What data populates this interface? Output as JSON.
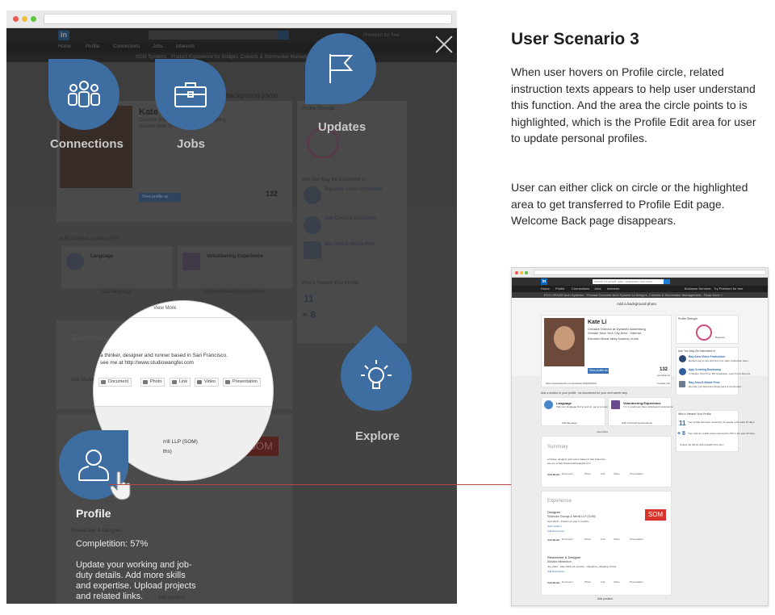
{
  "scenario": {
    "title": "User Scenario 3",
    "paragraph1": "When user hovers on Profile circle, related instruction texts appears to help user understand this function. And the area the circle points to is highlighted, which is the Profile Edit area for user to update personal profiles.",
    "paragraph2": "User can either click on circle or the highlighted area to get transferred to Profile Edit page. Welcome Back page disappears."
  },
  "overlay": {
    "connections_label": "Connections",
    "jobs_label": "Jobs",
    "updates_label": "Updates",
    "explore_label": "Explore",
    "profile_label": "Profile",
    "profile_completion": "Completition: 57%",
    "profile_description": "Update your working and job-duty details. Add more skills and expertise. Upload projects and related links."
  },
  "magnifier": {
    "view_more": "View More",
    "summary_line1": "a thinker, designer and runner based in San Francisco.",
    "summary_line2": "see me at http://www.studiowangfei.com",
    "media_buttons": [
      "Document",
      "Photo",
      "Link",
      "Video",
      "Presentation"
    ],
    "company_fragment": "rrill LLP (SOM)",
    "dates_fragment": "ths)"
  },
  "dim_page": {
    "logo": "in",
    "nav": [
      "Home",
      "Profile",
      "Connections",
      "Jobs",
      "Interests"
    ],
    "premium": "Premium for free",
    "banner": "SOM Systems · Product Experience for Bridges, Culverts & Stormwater Management",
    "bg_photo": "background photo",
    "name": "Kate Li",
    "headline": "Creative Director at Dynamic Advertising",
    "location": "Greater New York City Area",
    "view_profile": "View profile as",
    "connections_count": "132",
    "profile_strength": "Profile Strength",
    "ads_title": "Ads You May Be Interested In",
    "ad1": "Bay Area Video Production",
    "ad2": "App Creating Bootcamp",
    "ad3": "Bay Area E-Waste Pros",
    "who_viewed": "Who's Viewed Your Profile",
    "viewed_count": "11",
    "rank_change": "+ 8",
    "add_section": "Add a section to your profile",
    "language": "Language",
    "volunteering": "Volunteering Experience",
    "add_language": "Add language",
    "add_volunteering": "Add volunteering experience",
    "summary": "Summary",
    "add_media": "Add Media",
    "researcher": "Researcher & Designer",
    "add_position": "Add position",
    "som": "SOM"
  },
  "mini": {
    "logo": "in",
    "search_placeholder": "Search for people, jobs, companies, and more...",
    "nav": [
      "Home",
      "Profile",
      "Connections",
      "Jobs",
      "Interests"
    ],
    "nav_right": [
      "Business Services",
      "Try Premium for free"
    ],
    "banner": "ECO-SPAN® Arch Systems - Precast Concrete Arch System for Bridges, Culverts & Stormwater Management - Read More »",
    "add_bg_photo": "Add a background photo",
    "name": "Kate Li",
    "headline": "Creative Director at Dynamic Advertising",
    "location": "Greater New York City Area · Internet",
    "education": "Education   Illinois Valley Academy of Arts",
    "view_profile": "View profile as",
    "connections": "132",
    "connections_label": "connections",
    "profile_url": "https://www.linkedin.com/pub/kate-li/69/152/221",
    "contact_info": "Contact Info",
    "profile_strength": "Profile Strength",
    "beginner": "Beginner",
    "ads_title": "Ads You May Be Interested In",
    "ads": [
      {
        "title": "Bay Area Video Production",
        "text": "Excited way to hire and find your video production team."
      },
      {
        "title": "App Creating Bootcamp",
        "text": "In Weeks, Part-Time. 8% Graduates. Learn From Experts."
      },
      {
        "title": "Bay Area E-Waste Pros",
        "text": "Recycle your Electronic Equipment & Computers."
      }
    ],
    "add_section": "Add a section to your profile - be discovered for your next career step",
    "language": "Language",
    "language_text": "Talk your language first to and 4x. get to a maverick.",
    "volunteering": "Volunteering Experience",
    "volunteering_text": "7 in 1 employers have volunteered experience.",
    "add_language": "Add language",
    "add_volunteering": "Add volunteering experience",
    "who_viewed": "Who's Viewed Your Profile",
    "viewed_count": "11",
    "viewed_text": "Your profile has been viewed by 11 people in the past 15 days.",
    "rank_change": "+ 8",
    "rank_text": "Your rank for profile views improved by 8% in the past 30 days.",
    "unlock": "Unlock the full list with LinkedIn Premium",
    "view_more": "View More",
    "summary": "Summary",
    "summary_line1": "a thinker, designer and runner based in San Francisco.",
    "summary_line2": "see me at http://www.studiowangfei.com",
    "add_media": "Add Media",
    "media_buttons": [
      "Document",
      "Photo",
      "Link",
      "Video",
      "Presentation"
    ],
    "experience": "Experience",
    "job1_title": "Designer",
    "job1_company": "Skidmore Owings & Merrill LLP (SOM)",
    "job1_dates": "April 2015 – Present (1 year 5 months)",
    "add_location": "Add Location",
    "add_description": "Add Description",
    "som": "SOM",
    "job2_title": "Researcher & Designer",
    "job2_company": "Alibaba Inflosearch",
    "job2_dates": "July 2014 – May 2015 (11 months) · Hangzhou, Zhejiang, China",
    "add_position": "Add position"
  }
}
